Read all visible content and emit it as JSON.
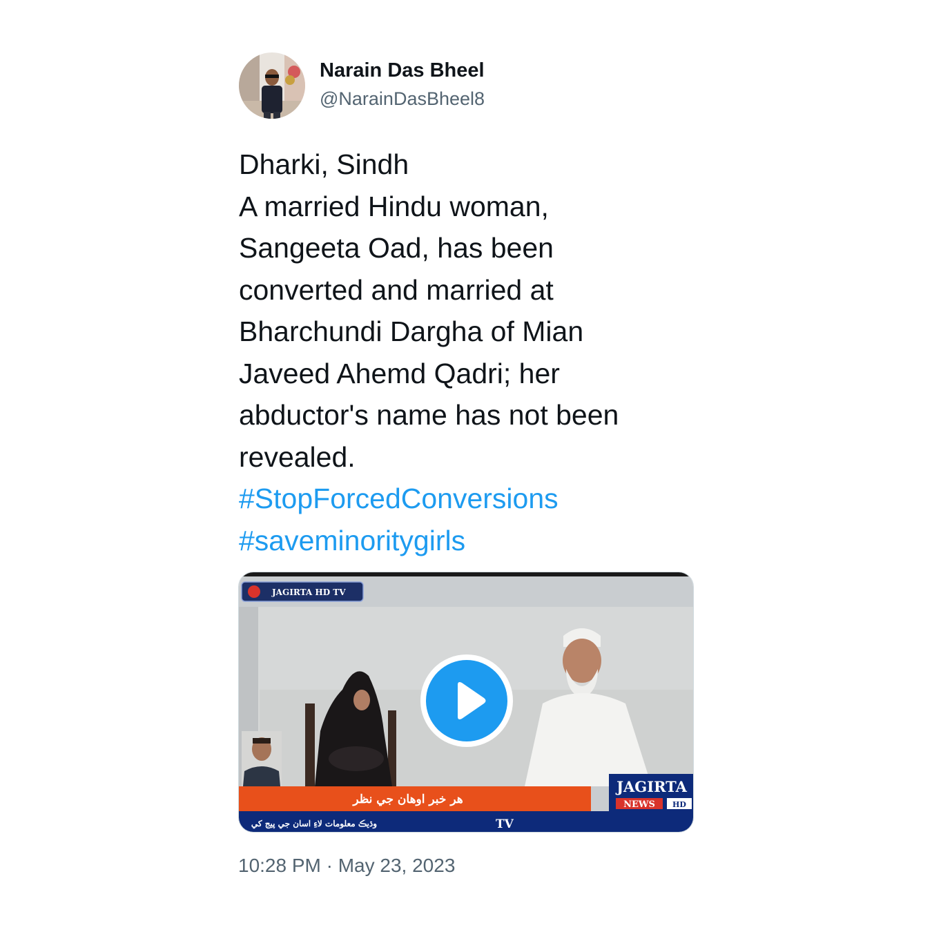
{
  "author": {
    "display_name": "Narain Das Bheel",
    "handle": "@NarainDasBheel8"
  },
  "tweet": {
    "lines": [
      "Dharki, Sindh",
      "A married Hindu woman,",
      "Sangeeta Oad, has been",
      "converted and married at",
      "Bharchundi Dargha of Mian",
      "Javeed Ahemd Qadri; her",
      "abductor's name has not been",
      "revealed."
    ],
    "hashtags": [
      "#StopForcedConversions",
      "#saveminoritygirls"
    ]
  },
  "media": {
    "type": "video",
    "channel_tag": "JAGIRTA HD TV",
    "ticker_headline": "هر خبر اوهان جي نظر",
    "ticker_bottom": "وڌيڪ معلومات لاءِ اسان جي پيج کي",
    "ticker_tv": "TV",
    "brand_name": "JAGIRTA",
    "brand_sub": "NEWS",
    "brand_hd": "HD",
    "play_icon": "play-icon"
  },
  "timestamp": "10:28 PM · May 23, 2023",
  "colors": {
    "accent": "#1d9bf0",
    "text": "#0f1419",
    "secondary": "#536471",
    "ticker_orange": "#e8501b",
    "ticker_blue": "#0d2a7a"
  }
}
